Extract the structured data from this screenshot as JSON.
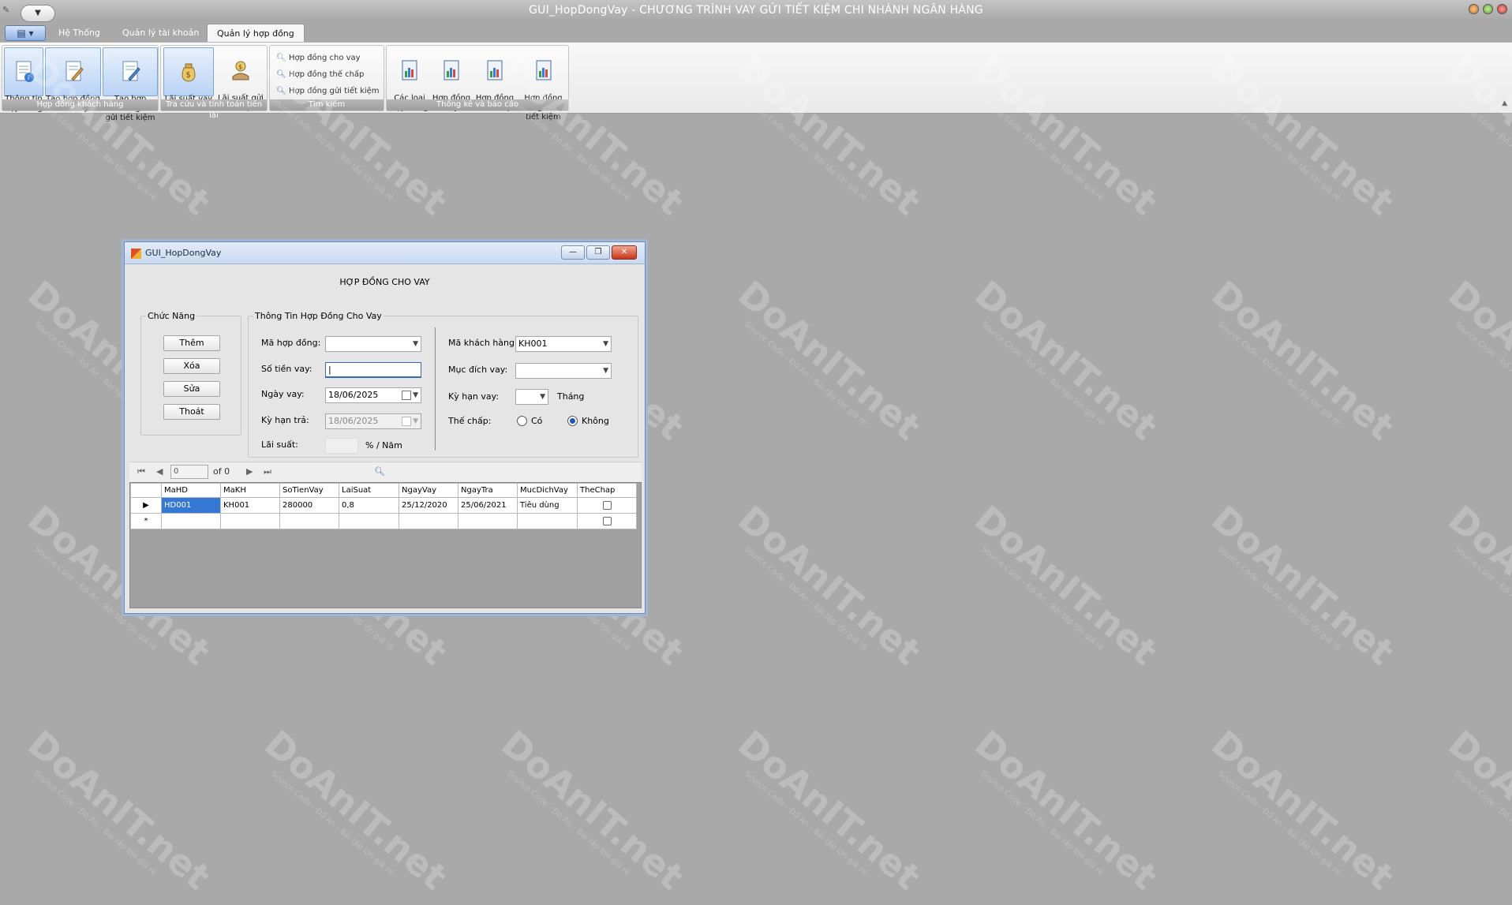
{
  "window": {
    "title": "GUI_HopDongVay - CHƯƠNG TRÌNH VAY GỬI TIẾT KIỆM CHI NHÁNH NGÂN HÀNG"
  },
  "ribbon": {
    "tabs": [
      {
        "label": "Hệ Thống"
      },
      {
        "label": "Quản lý tài khoản"
      },
      {
        "label": "Quản lý hợp đồng"
      }
    ],
    "groups": [
      {
        "label": "Hợp đồng khách hàng",
        "buttons": [
          {
            "label": "Thông tin\nhợp đồng"
          },
          {
            "label": "Tạo hợp đồng\ncho vay"
          },
          {
            "label": "Tạo hợp đồng\ngửi tiết kiệm"
          }
        ]
      },
      {
        "label": "Tra cứu và tính toán tiền lãi",
        "buttons": [
          {
            "label": "Lãi suất vay"
          },
          {
            "label": "Lãi suất gửi\ntiết kiệm"
          }
        ]
      },
      {
        "label": "Tìm kiếm",
        "buttons": [
          {
            "label": "Hợp đồng cho vay"
          },
          {
            "label": "Hợp đồng thế chấp"
          },
          {
            "label": "Hợp đồng gửi tiết kiệm"
          }
        ]
      },
      {
        "label": "Thống kê và báo cáo",
        "buttons": [
          {
            "label": "Các loại\nhợp đồng"
          },
          {
            "label": "Hợp đồng\nvay"
          },
          {
            "label": "Hợp đồng\nthế chấp"
          },
          {
            "label": "Hợp đồng gửi\ntiết kiệm"
          }
        ]
      }
    ]
  },
  "watermark": {
    "brand": "DoAnIT.net",
    "tagline": "Source Code - Đồ Án - Bài tập lớn giá rẻ"
  },
  "child": {
    "title": "GUI_HopDongVay",
    "heading": "HỢP ĐỒNG CHO VAY",
    "chuc_nang": {
      "legend": "Chức Năng",
      "buttons": [
        "Thêm",
        "Xóa",
        "Sửa",
        "Thoát"
      ]
    },
    "thong_tin": {
      "legend": "Thông Tin Hợp Đồng Cho Vay",
      "ma_hop_dong": {
        "label": "Mã hợp đồng:",
        "value": ""
      },
      "so_tien_vay": {
        "label": "Số tiền vay:",
        "value": ""
      },
      "ngay_vay": {
        "label": "Ngày vay:",
        "value": "18/06/2025"
      },
      "ky_han_tra": {
        "label": "Kỳ hạn trả:",
        "value": "18/06/2025"
      },
      "lai_suat": {
        "label": "Lãi suất:",
        "value": "",
        "unit": "% / Năm"
      },
      "ma_khach_hang": {
        "label": "Mã khách hàng:",
        "value": "KH001"
      },
      "muc_dich_vay": {
        "label": "Mục đích vay:",
        "value": ""
      },
      "ky_han_vay": {
        "label": "Kỳ hạn vay:",
        "value": "",
        "unit": "Tháng"
      },
      "the_chap": {
        "label": "Thế chấp:",
        "options": [
          "Có",
          "Không"
        ],
        "selected": "Không"
      }
    },
    "navigator": {
      "position": "0",
      "of": "of 0"
    },
    "grid": {
      "columns": [
        "MaHD",
        "MaKH",
        "SoTienVay",
        "LaiSuat",
        "NgayVay",
        "NgayTra",
        "MucDichVay",
        "TheChap"
      ],
      "rows": [
        [
          "HD001",
          "KH001",
          "280000",
          "0,8",
          "25/12/2020",
          "25/06/2021",
          "Tiêu dùng",
          ""
        ]
      ]
    }
  }
}
